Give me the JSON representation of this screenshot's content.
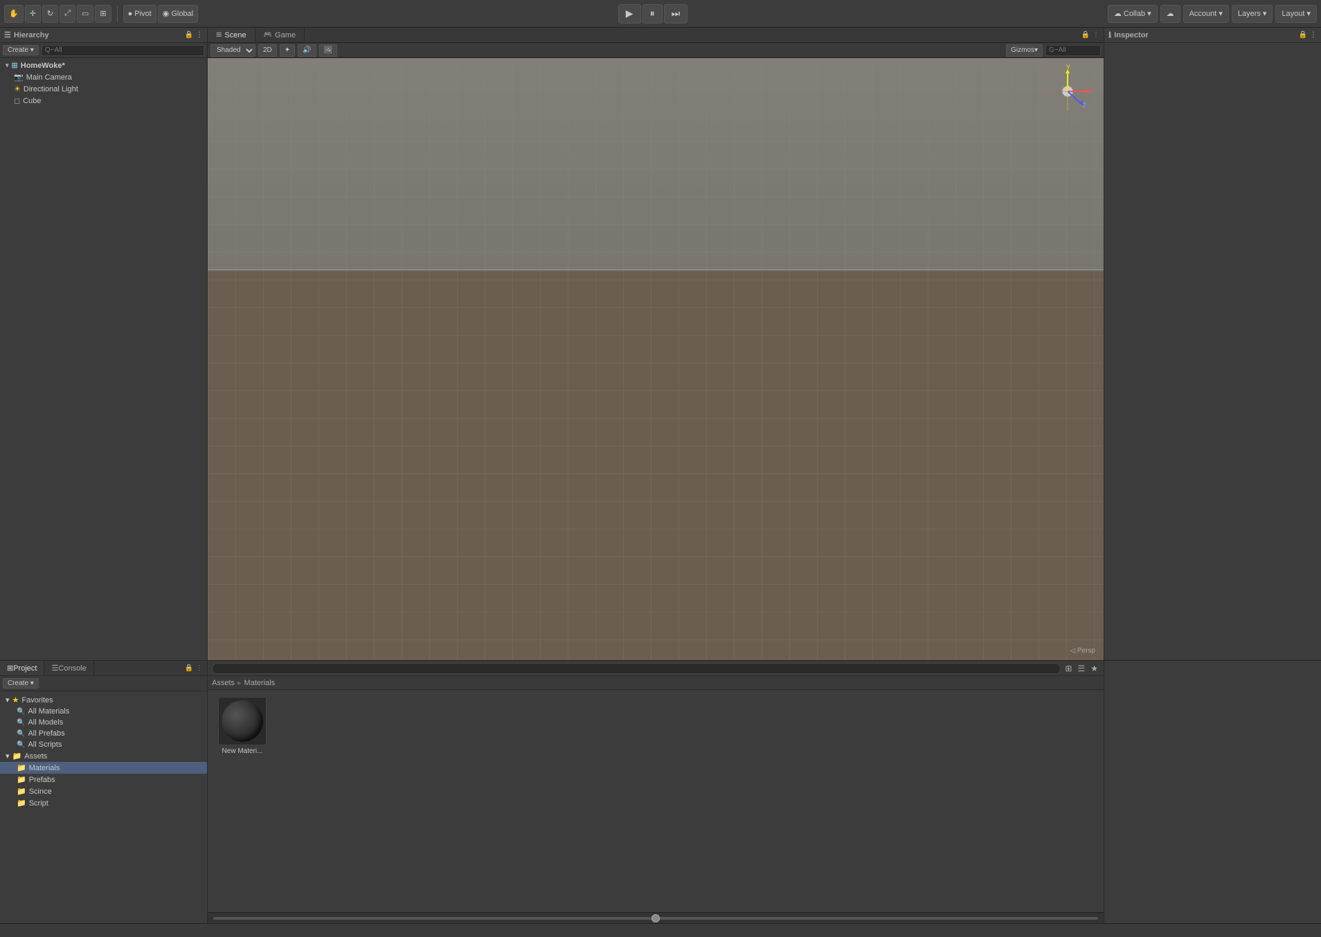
{
  "topbar": {
    "pivot_label": "Pivot",
    "global_label": "Global",
    "collab_label": "Collab",
    "account_label": "Account",
    "layers_label": "Layers",
    "layout_label": "Layout"
  },
  "hierarchy": {
    "panel_title": "Hierarchy",
    "create_label": "Create",
    "search_placeholder": "Q~All",
    "scene_name": "HomeWoke*",
    "items": [
      {
        "label": "Main Camera",
        "type": "camera"
      },
      {
        "label": "Directional Light",
        "type": "light"
      },
      {
        "label": "Cube",
        "type": "cube"
      }
    ]
  },
  "scene": {
    "tab_scene": "Scene",
    "tab_game": "Game",
    "shading_mode": "Shaded",
    "btn_2d": "2D",
    "gizmos_label": "Gizmos",
    "persp_label": "◁ Persp",
    "search_placeholder": "G~All"
  },
  "inspector": {
    "panel_title": "Inspector"
  },
  "project": {
    "tab_project": "Project",
    "tab_console": "Console",
    "create_label": "Create",
    "breadcrumb": {
      "assets": "Assets",
      "materials": "Materials"
    },
    "favorites": {
      "label": "Favorites",
      "items": [
        "All Materials",
        "All Models",
        "All Prefabs",
        "All Scripts"
      ]
    },
    "assets": {
      "label": "Assets",
      "folders": [
        {
          "label": "Materials",
          "selected": true
        },
        {
          "label": "Prefabs"
        },
        {
          "label": "Scince"
        },
        {
          "label": "Script"
        }
      ]
    },
    "material_item": {
      "label": "New Materi..."
    }
  },
  "layers": {
    "label": "Layers"
  },
  "account": {
    "label": "Account"
  },
  "statusbar": {
    "text": ""
  },
  "icons": {
    "play": "▶",
    "pause": "⏸",
    "step": "⏭",
    "arrow_down": "▾",
    "arrow_right": "▸",
    "lock": "🔒",
    "cloud": "☁",
    "folder": "📁",
    "scene_icon": "⊞",
    "camera_icon": "📷",
    "light_icon": "☀",
    "cube_icon": "◻",
    "search_q": "🔍"
  }
}
